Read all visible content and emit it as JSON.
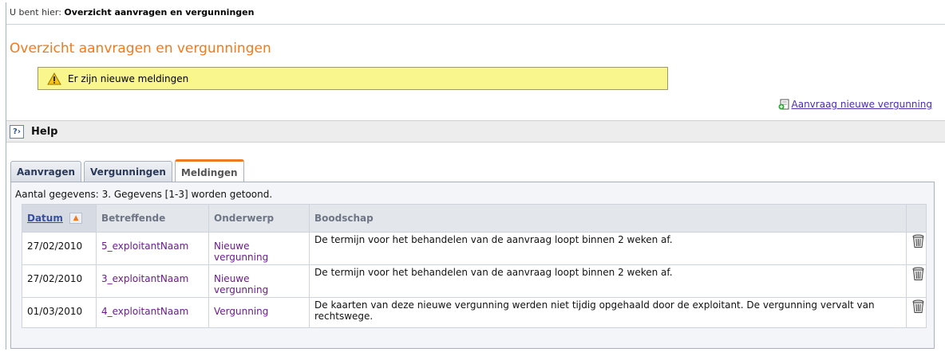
{
  "breadcrumb": {
    "prefix": "U bent hier:",
    "current": "Overzicht aanvragen en vergunningen"
  },
  "page": {
    "title": "Overzicht aanvragen en vergunningen"
  },
  "notice": {
    "text": "Er zijn nieuwe meldingen",
    "icon": "warning-icon"
  },
  "actions": {
    "new_license_link": "Aanvraag nieuwe vergunning"
  },
  "help": {
    "label": "Help",
    "icon": "help-icon"
  },
  "tabs": [
    {
      "label": "Aanvragen",
      "active": false
    },
    {
      "label": "Vergunningen",
      "active": false
    },
    {
      "label": "Meldingen",
      "active": true
    }
  ],
  "table": {
    "count_text": "Aantal gegevens: 3. Gegevens [1-3] worden getoond.",
    "columns": [
      "Datum",
      "Betreffende",
      "Onderwerp",
      "Boodschap"
    ],
    "rows": [
      {
        "datum": "27/02/2010",
        "betreffende": "5_exploitantNaam",
        "onderwerp": "Nieuwe vergunning",
        "boodschap": "De termijn voor het behandelen van de aanvraag loopt binnen 2 weken af."
      },
      {
        "datum": "27/02/2010",
        "betreffende": "3_exploitantNaam",
        "onderwerp": "Nieuwe vergunning",
        "boodschap": "De termijn voor het behandelen van de aanvraag loopt binnen 2 weken af."
      },
      {
        "datum": "01/03/2010",
        "betreffende": "4_exploitantNaam",
        "onderwerp": "Vergunning",
        "boodschap": "De kaarten van deze nieuwe vergunning werden niet tijdig opgehaald door de exploitant. De vergunning vervalt van rechtswege."
      }
    ]
  },
  "colors": {
    "accent": "#f07a1e",
    "link": "#6a1c8a",
    "notice_bg": "#f8f68d"
  }
}
